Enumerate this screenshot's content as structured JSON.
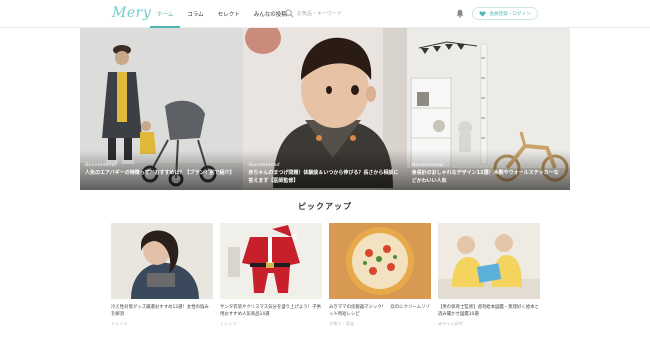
{
  "header": {
    "logo": "Mery",
    "nav": [
      {
        "label": "ホーム",
        "active": true
      },
      {
        "label": "コラム",
        "active": false
      },
      {
        "label": "セレクト",
        "active": false
      },
      {
        "label": "みんなの投稿",
        "active": false
      }
    ],
    "search_placeholder": "お気品・キーワード",
    "login_label": "会員登録・ログイン",
    "accent_color": "#4fb8b2"
  },
  "hero": [
    {
      "badge": "Recommend",
      "caption": "人気のエアバギーの特徴って？おすすめは？【ブランド別で紹介】"
    },
    {
      "badge": "Recommend",
      "caption": "赤ちゃんのまつげ問題！体験談＆いつから伸びる？長さから相談に答えます【医師監修】"
    },
    {
      "badge": "Recommend",
      "caption": "身長計のおしゃれなデザイン12選！木製やウォールステッカーなどかわいい人気"
    }
  ],
  "section": {
    "title": "ピックアップ"
  },
  "cards": [
    {
      "title": "冷え性対策グッズ厳選おすすめ12選！女性の悩みを解消",
      "tag": "トレンド"
    },
    {
      "title": "サンタ衣装やクリスマス気分を盛り上げよう！子供用おすすめ人気商品14選",
      "tag": "トレンド"
    },
    {
      "title": "みきママの炊飯器マジック！　炊のにクリームリゾット時短レシピ",
      "tag": "子育て・家族"
    },
    {
      "title": "【男の保育士監修】週刊絵本図鑑・無理好く絵本と読み聞かせ図鑑10選",
      "tag": "赤ちゃん研究"
    }
  ]
}
